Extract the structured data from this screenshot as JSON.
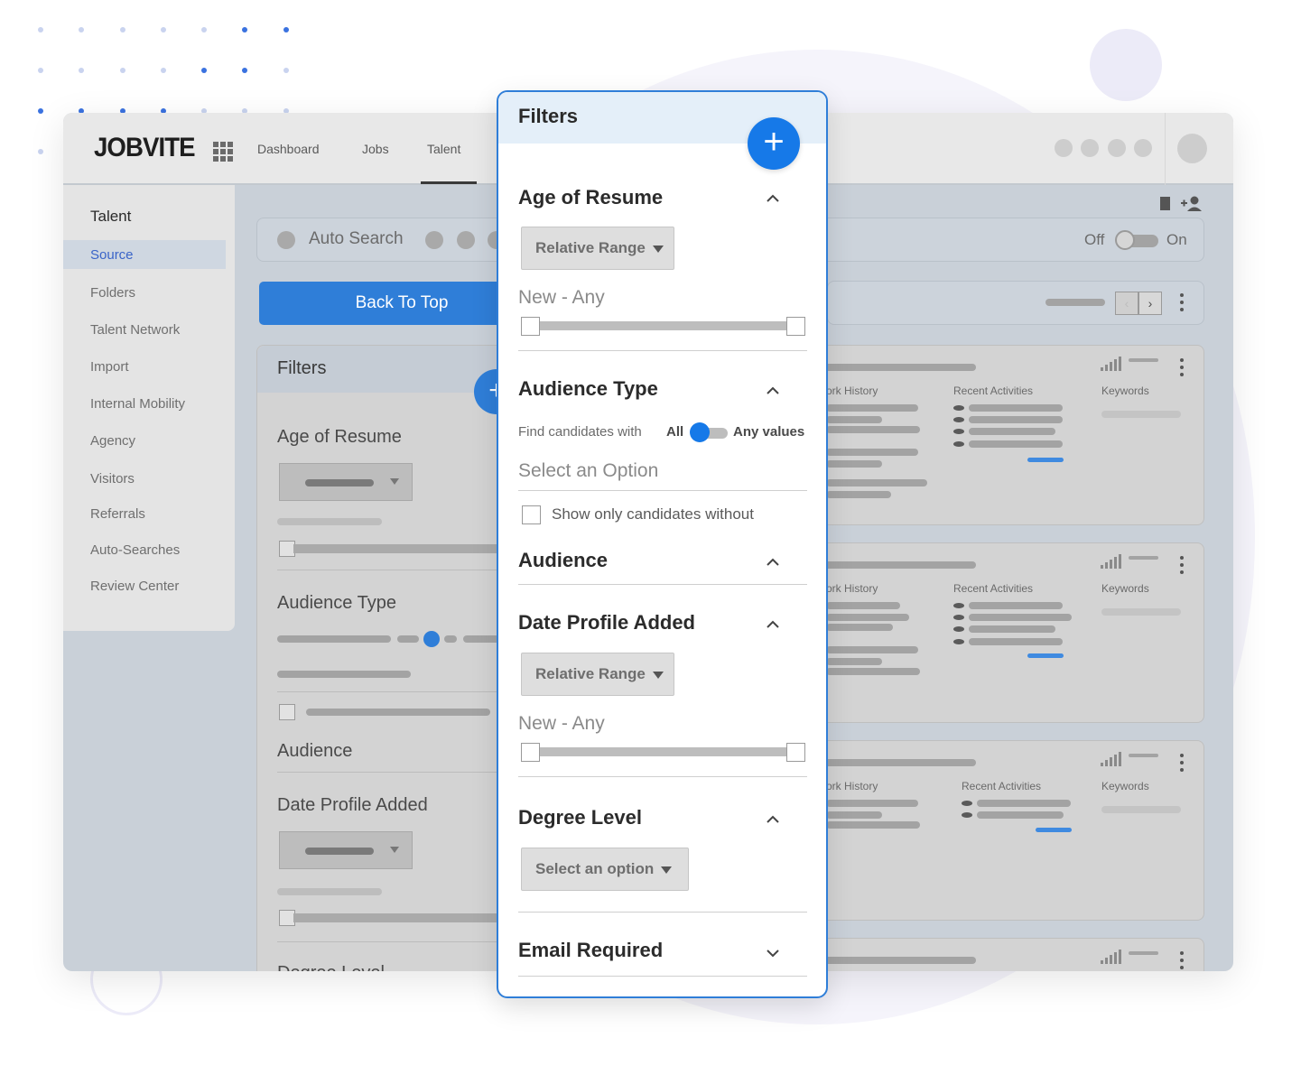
{
  "app": {
    "logo": "JOBVITE",
    "nav": [
      "Dashboard",
      "Jobs",
      "Talent"
    ]
  },
  "sidebar": {
    "title": "Talent",
    "items": [
      "Source",
      "Folders",
      "Talent Network",
      "Import",
      "Internal Mobility",
      "Agency",
      "Visitors",
      "Referrals",
      "Auto-Searches",
      "Review Center"
    ],
    "active": "Source"
  },
  "search": {
    "label": "Auto Search",
    "toggle_off": "Off",
    "toggle_on": "On"
  },
  "back_to_top": "Back To Top",
  "filters_bg": {
    "title": "Filters",
    "sections": [
      "Age of Resume",
      "Audience Type",
      "Audience",
      "Date Profile Added",
      "Degree Level"
    ]
  },
  "cards": {
    "col1": "ork History",
    "col2": "Recent Activities",
    "col3": "Keywords"
  },
  "panel": {
    "title": "Filters",
    "age_of_resume": {
      "title": "Age of Resume",
      "select": "Relative Range",
      "range": "New - Any"
    },
    "audience_type": {
      "title": "Audience Type",
      "find_text": "Find candidates with",
      "all": "All",
      "any_values": "Any values",
      "select_placeholder": "Select an Option",
      "checkbox_label": "Show only candidates without"
    },
    "audience": {
      "title": "Audience"
    },
    "date_profile_added": {
      "title": "Date Profile Added",
      "select": "Relative Range",
      "range": "New - Any"
    },
    "degree_level": {
      "title": "Degree Level",
      "select": "Select an option"
    },
    "email_required": {
      "title": "Email Required"
    }
  },
  "colors": {
    "accent": "#1679e8",
    "panel_header": "#e4eff9",
    "active_nav": "#3a64c8"
  }
}
